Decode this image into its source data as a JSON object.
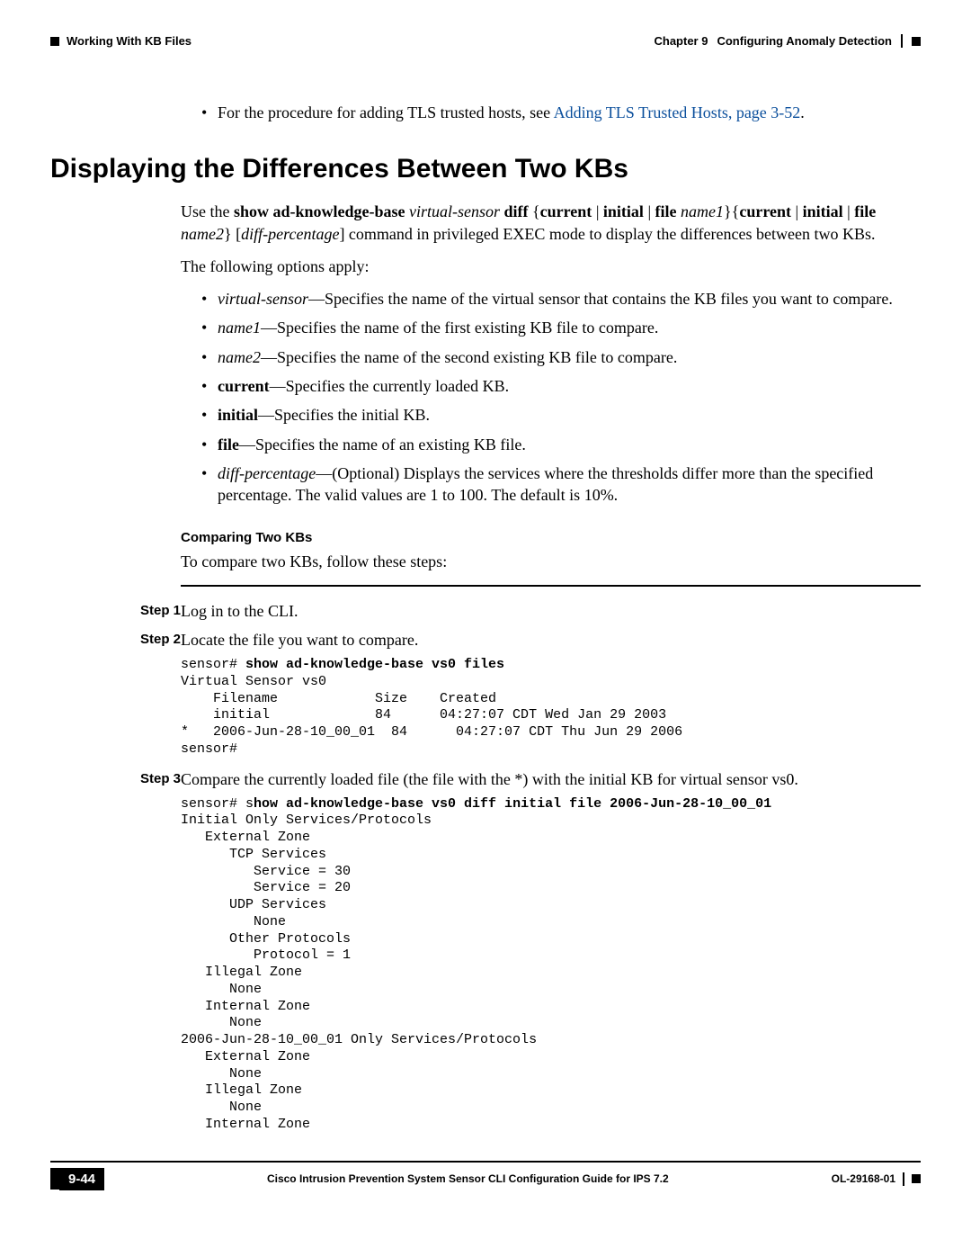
{
  "header": {
    "left": "Working With KB Files",
    "right_chapter": "Chapter 9",
    "right_title": "Configuring Anomaly Detection"
  },
  "top_bullet": {
    "prefix": "For the procedure for adding TLS trusted hosts, see ",
    "link": "Adding TLS Trusted Hosts, page 3-52",
    "suffix": "."
  },
  "section_heading": "Displaying the Differences Between Two KBs",
  "intro1_parts": [
    {
      "t": "Use the "
    },
    {
      "t": "show ad-knowledge-base",
      "b": true
    },
    {
      "t": " "
    },
    {
      "t": "virtual-sensor",
      "i": true
    },
    {
      "t": " "
    },
    {
      "t": "diff",
      "b": true
    },
    {
      "t": " {"
    },
    {
      "t": "current",
      "b": true
    },
    {
      "t": " | "
    },
    {
      "t": "initial",
      "b": true
    },
    {
      "t": " | "
    },
    {
      "t": "file",
      "b": true
    },
    {
      "t": " "
    },
    {
      "t": "name1",
      "i": true
    },
    {
      "t": "}{"
    },
    {
      "t": "current",
      "b": true
    },
    {
      "t": " | "
    },
    {
      "t": "initial",
      "b": true
    },
    {
      "t": " | "
    },
    {
      "t": "file",
      "b": true
    },
    {
      "t": " "
    },
    {
      "t": "name2",
      "i": true
    },
    {
      "t": "} ["
    },
    {
      "t": "diff-percentage",
      "i": true
    },
    {
      "t": "] command in privileged EXEC mode to display the differences between two KBs."
    }
  ],
  "intro2": "The following options apply:",
  "options": [
    [
      {
        "t": "virtual-sensor",
        "i": true
      },
      {
        "t": "—Specifies the name of the virtual sensor that contains the KB files you want to compare."
      }
    ],
    [
      {
        "t": "name1",
        "i": true
      },
      {
        "t": "—Specifies the name of the first existing KB file to compare."
      }
    ],
    [
      {
        "t": "name2",
        "i": true
      },
      {
        "t": "—Specifies the name of the second existing KB file to compare."
      }
    ],
    [
      {
        "t": "current",
        "b": true
      },
      {
        "t": "—Specifies the currently loaded KB."
      }
    ],
    [
      {
        "t": "initial",
        "b": true
      },
      {
        "t": "—Specifies the initial KB."
      }
    ],
    [
      {
        "t": "file",
        "b": true
      },
      {
        "t": "—Specifies the name of an existing KB file."
      }
    ],
    [
      {
        "t": "diff-percentage",
        "i": true
      },
      {
        "t": "—(Optional) Displays the services where the thresholds differ more than the specified percentage. The valid values are 1 to 100. The default is 10%."
      }
    ]
  ],
  "subhead": "Comparing Two KBs",
  "subpara": "To compare two KBs, follow these steps:",
  "steps": [
    {
      "label": "Step 1",
      "text": "Log in to the CLI."
    },
    {
      "label": "Step 2",
      "text": "Locate the file you want to compare."
    }
  ],
  "code1": {
    "prompt": "sensor# ",
    "cmd": "show ad-knowledge-base vs0 files",
    "lines": [
      "Virtual Sensor vs0",
      "    Filename            Size    Created",
      "    initial             84      04:27:07 CDT Wed Jan 29 2003",
      "*   2006-Jun-28-10_00_01  84      04:27:07 CDT Thu Jun 29 2006",
      "sensor#"
    ]
  },
  "step3": {
    "label": "Step 3",
    "text": "Compare the currently loaded file (the file with the *) with the initial KB for virtual sensor vs0."
  },
  "code2": {
    "prompt": "sensor# s",
    "cmd": "how ad-knowledge-base vs0 diff initial file 2006-Jun-28-10_00_01",
    "lines": [
      "Initial Only Services/Protocols",
      "   External Zone",
      "      TCP Services",
      "         Service = 30",
      "         Service = 20",
      "      UDP Services",
      "         None",
      "      Other Protocols",
      "         Protocol = 1",
      "   Illegal Zone",
      "      None",
      "   Internal Zone",
      "      None",
      "2006-Jun-28-10_00_01 Only Services/Protocols",
      "   External Zone",
      "      None",
      "   Illegal Zone",
      "      None",
      "   Internal Zone"
    ]
  },
  "footer": {
    "page": "9-44",
    "title": "Cisco Intrusion Prevention System Sensor CLI Configuration Guide for IPS 7.2",
    "doc": "OL-29168-01"
  }
}
